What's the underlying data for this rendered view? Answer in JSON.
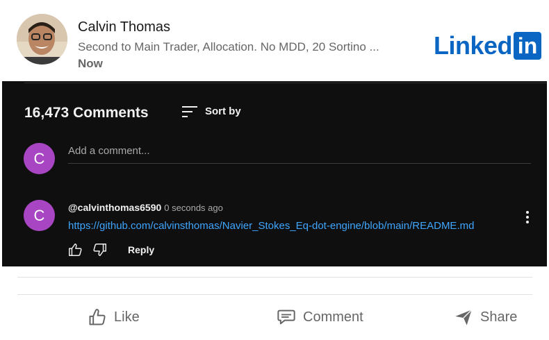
{
  "post": {
    "author": "Calvin Thomas",
    "headline": "Second to Main Trader, Allocation. No MDD, 20 Sortino ...",
    "time": "Now",
    "brand": {
      "text": "Linked",
      "box": "in",
      "color": "#0a66c2"
    }
  },
  "embed": {
    "comment_count": "16,473 Comments",
    "sort_label": "Sort by",
    "add_comment_placeholder": "Add a comment...",
    "user_initial": "C",
    "comment": {
      "avatar_initial": "C",
      "handle": "@calvinthomas6590",
      "time_ago": "0 seconds ago",
      "text": "https://github.com/calvinsthomas/Navier_Stokes_Eq-dot-engine/blob/main/README.md",
      "reply_label": "Reply"
    },
    "colors": {
      "panel_bg": "#0f0f0f",
      "avatar": "#a845c2",
      "link": "#3ea6ff"
    }
  },
  "actions": {
    "like": "Like",
    "comment": "Comment",
    "share": "Share"
  }
}
